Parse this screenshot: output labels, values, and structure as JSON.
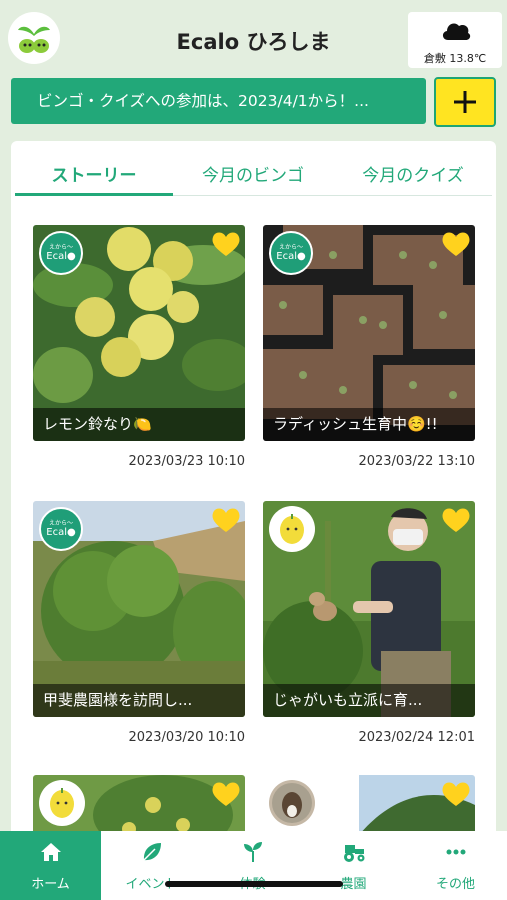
{
  "header": {
    "title": "Ecalo ひろしま",
    "weather": {
      "text": "倉敷 13.8℃",
      "icon": "cloud-icon"
    }
  },
  "banner": {
    "text": "ビンゴ・クイズへの参加は、2023/4/1から！...",
    "add_icon": "plus-icon"
  },
  "tabs": [
    {
      "label": "ストーリー",
      "active": true
    },
    {
      "label": "今月のビンゴ",
      "active": false
    },
    {
      "label": "今月のクイズ",
      "active": false
    }
  ],
  "badge_text": {
    "small": "えから～",
    "big": "Ecal●"
  },
  "stories": [
    {
      "caption": "レモン鈴なり🍋",
      "date": "2023/03/23 10:10",
      "avatar": "ecalo-badge"
    },
    {
      "caption": "ラディッシュ生育中☺️!!",
      "date": "2023/03/22 13:10",
      "avatar": "ecalo-badge"
    },
    {
      "caption": "甲斐農園様を訪問し...",
      "date": "2023/03/20 10:10",
      "avatar": "ecalo-badge"
    },
    {
      "caption": "じゃがいも立派に育...",
      "date": "2023/02/24 12:01",
      "avatar": "lemon-avatar"
    },
    {
      "caption": "",
      "date": "",
      "avatar": "lemon-avatar"
    },
    {
      "caption": "",
      "date": "",
      "avatar": "goat-avatar"
    }
  ],
  "tabbar": [
    {
      "label": "ホーム",
      "icon": "home-icon",
      "active": true
    },
    {
      "label": "イベント",
      "icon": "leaf-icon",
      "active": false
    },
    {
      "label": "体験",
      "icon": "sprout-icon",
      "active": false
    },
    {
      "label": "農園",
      "icon": "tractor-icon",
      "active": false
    },
    {
      "label": "その他",
      "icon": "more-icon",
      "active": false
    }
  ],
  "colors": {
    "accent": "#22a879",
    "background": "#e3eedf",
    "highlight": "#ffe421",
    "heart": "#ffd21e"
  }
}
